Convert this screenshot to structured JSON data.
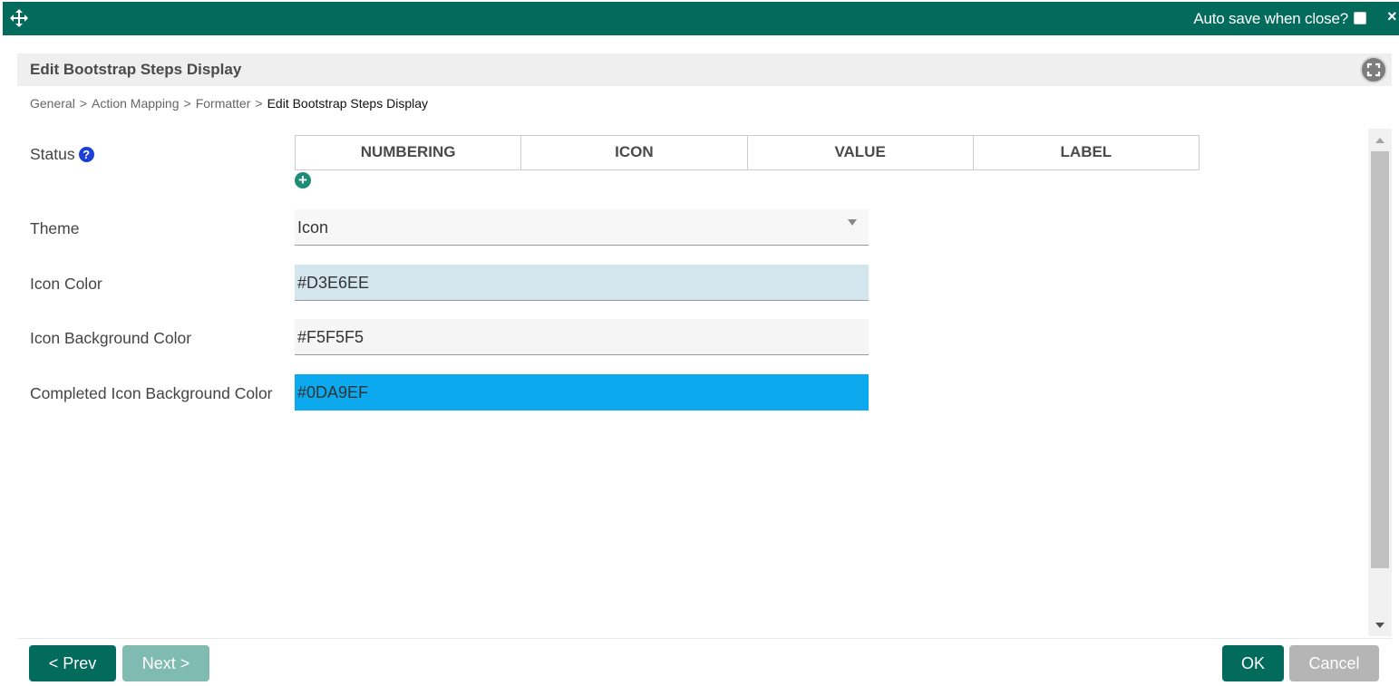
{
  "titlebar": {
    "autosave_label": "Auto save when close?",
    "autosave_checked": false,
    "close_glyph": "×",
    "move_icon": "move-arrows-icon"
  },
  "header": {
    "title": "Edit Bootstrap Steps Display",
    "fullscreen_icon": "fullscreen-icon"
  },
  "breadcrumb": {
    "items": [
      "General",
      "Action Mapping",
      "Formatter"
    ],
    "separator": ">",
    "current": "Edit Bootstrap Steps Display"
  },
  "form": {
    "status": {
      "label": "Status",
      "help_glyph": "?",
      "columns": [
        "NUMBERING",
        "ICON",
        "VALUE",
        "LABEL"
      ],
      "add_glyph": "+"
    },
    "theme": {
      "label": "Theme",
      "value": "Icon"
    },
    "icon_color": {
      "label": "Icon Color",
      "value": "#D3E6EE",
      "swatch": "#D3E6EE"
    },
    "icon_background_color": {
      "label": "Icon Background Color",
      "value": "#F5F5F5",
      "swatch": "#F5F5F5"
    },
    "completed_icon_background_color": {
      "label": "Completed Icon Background Color",
      "value": "#0DA9EF",
      "swatch": "#0DA9EF"
    }
  },
  "footer": {
    "prev_label": "< Prev",
    "next_label": "Next >",
    "ok_label": "OK",
    "cancel_label": "Cancel"
  },
  "colors": {
    "brand": "#026B5C",
    "disabled_brand": "#7FBBB1",
    "cancel": "#B5B5B5",
    "help": "#1C3FD6"
  }
}
